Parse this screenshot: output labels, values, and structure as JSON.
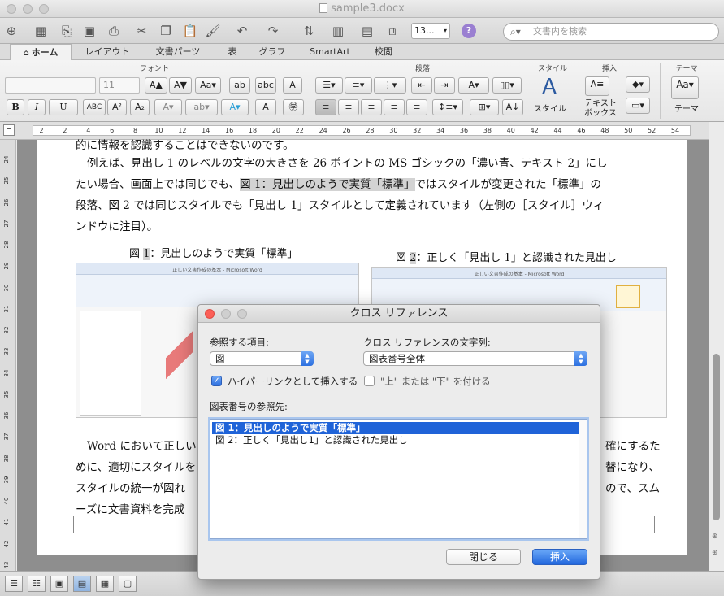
{
  "window": {
    "title": "sample3.docx"
  },
  "toolbar": {
    "zoom": "13...",
    "search_placeholder": "文書内を検索"
  },
  "tabs": [
    {
      "label": "ホーム",
      "active": true
    },
    {
      "label": "レイアウト"
    },
    {
      "label": "文書パーツ"
    },
    {
      "label": "表"
    },
    {
      "label": "グラフ"
    },
    {
      "label": "SmartArt"
    },
    {
      "label": "校閲"
    }
  ],
  "ribbon": {
    "groups": {
      "font": "フォント",
      "paragraph": "段落",
      "style": "スタイル",
      "insert": "挿入",
      "theme": "テーマ"
    },
    "font_size": "11",
    "style_label": "スタイル",
    "textbox_label_1": "テキスト",
    "textbox_label_2": "ボックス",
    "theme_label": "テーマ",
    "bold": "B",
    "italic": "I",
    "underline": "U",
    "strike": "ABC"
  },
  "ruler": {
    "numbers": [
      "2",
      "2",
      "4",
      "6",
      "8",
      "10",
      "12",
      "14",
      "16",
      "18",
      "20",
      "22",
      "24",
      "26",
      "28",
      "30",
      "32",
      "34",
      "36",
      "38",
      "40",
      "42",
      "44",
      "46",
      "48",
      "50",
      "52",
      "54"
    ]
  },
  "vruler": {
    "numbers": [
      "24",
      "25",
      "26",
      "27",
      "28",
      "29",
      "30",
      "31",
      "32",
      "33",
      "34",
      "35",
      "36",
      "37",
      "38",
      "39",
      "40",
      "41",
      "42",
      "43"
    ]
  },
  "document": {
    "line0": "的に情報を認識することはできないのです。",
    "line1": "例えば、見出し 1 のレベルの文字の大きさを 26 ポイントの MS ゴシックの「濃い青、テキスト 2」にし",
    "line2a": "たい場合、画面上では同じでも、",
    "line2hl": "図 1：見出しのようで実質「標準」",
    "line2b": "ではスタイルが変更された「標準」の",
    "line3": "段落、図 2 では同じスタイルでも「見出し 1」スタイルとして定義されています（左側の［スタイル］ウィ",
    "line4": "ンドウに注目）。",
    "caption1_a": "図 ",
    "caption1_hl": "1",
    "caption1_b": "：見出しのようで実質「標準」",
    "caption2_a": "図 ",
    "caption2_hl": "2",
    "caption2_b": "：正しく「見出し 1」と認識された見出し",
    "fig_title": "正しい文書作成の基本 - Microsoft Word",
    "line5": "Word において正しい",
    "line5r": "確にするた",
    "line6": "めに、適切にスタイルを",
    "line6r": "替になり、",
    "line7": "スタイルの統一が図れ",
    "line7r": "ので、スム",
    "line8": "ーズに文書資料を完成"
  },
  "dialog": {
    "title": "クロス リファレンス",
    "ref_type_label": "参照する項目:",
    "ref_type_value": "図",
    "insert_ref_label": "クロス リファレンスの文字列:",
    "insert_ref_value": "図表番号全体",
    "hyperlink_label": "ハイパーリンクとして挿入する",
    "hyperlink_checked": true,
    "above_below_label": "\"上\" または \"下\" を付ける",
    "above_below_checked": false,
    "list_label": "図表番号の参照先:",
    "items": [
      {
        "text": "図 1：見出しのようで実質「標準」",
        "selected": true
      },
      {
        "text": "図 2：正しく「見出し1」と認識された見出し",
        "selected": false
      }
    ],
    "close_button": "閉じる",
    "insert_button": "挿入"
  },
  "colors": {
    "accent": "#2267dd",
    "selection": "#1f63d8"
  }
}
